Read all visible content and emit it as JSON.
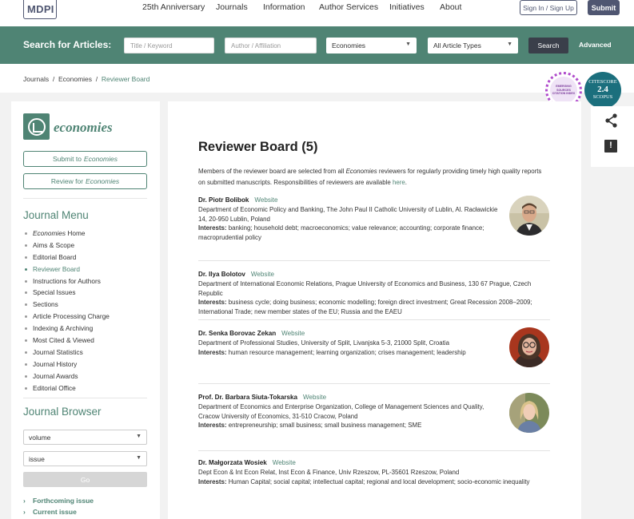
{
  "topnav": {
    "logo": "MDPI",
    "links": [
      "25th Anniversary",
      "Journals",
      "Information",
      "Author Services",
      "Initiatives",
      "About"
    ],
    "sign_in": "Sign In / Sign Up",
    "submit": "Submit"
  },
  "search": {
    "label": "Search for Articles:",
    "title_placeholder": "Title / Keyword",
    "author_placeholder": "Author / Affiliation",
    "journal_value": "Economies",
    "type_value": "All Article Types",
    "search_button": "Search",
    "advanced": "Advanced"
  },
  "breadcrumb": {
    "journals": "Journals",
    "sep": "/",
    "journal": "Economies",
    "current": "Reviewer Board"
  },
  "sidebar": {
    "journal_name": "economies",
    "submit_label": "Submit to",
    "review_label": "Review for",
    "journal_italic": "Economies",
    "menu_heading": "Journal Menu",
    "menu_home_italic": "Economies",
    "menu_home_rest": " Home",
    "menu_items": [
      "Aims & Scope",
      "Editorial Board",
      "Reviewer Board",
      "Instructions for Authors",
      "Special Issues",
      "Sections",
      "Article Processing Charge",
      "Indexing & Archiving",
      "Most Cited & Viewed",
      "Journal Statistics",
      "Journal History",
      "Journal Awards",
      "Editorial Office"
    ],
    "browser_heading": "Journal Browser",
    "volume_value": "volume",
    "issue_value": "issue",
    "go_button": "Go",
    "forthcoming": "Forthcoming issue",
    "current_issue": "Current issue"
  },
  "main": {
    "title": "Reviewer Board (5)",
    "intro_part1": "Members of the reviewer board are selected from all ",
    "intro_italic": "Economies",
    "intro_part2": " reviewers for regularly providing timely high quality reports on submitted manuscripts. Responsibilities of reviewers are available ",
    "intro_link": "here",
    "intro_end": ".",
    "website_label": "Website",
    "interests_label": "Interests:",
    "reviewers": [
      {
        "name": "Dr. Piotr Bolibok",
        "affiliation": "Department of Economic Policy and Banking, The John Paul II Catholic University of Lublin, Al. Racławickie 14, 20-950 Lublin, Poland",
        "interests": "banking; household debt; macroeconomics; value relevance; accounting; corporate finance; macroprudential policy"
      },
      {
        "name": "Dr. Ilya Bolotov",
        "affiliation": "Department of International Economic Relations, Prague University of Economics and Business, 130 67 Prague, Czech Republic",
        "interests": "business cycle; doing business; economic modelling; foreign direct investment; Great Recession 2008–2009; International Trade; new member states of the EU; Russia and the EAEU"
      },
      {
        "name": "Dr. Senka Borovac Zekan",
        "affiliation": "Department of Professional Studies, University of Split, Livanjska 5-3, 21000 Split, Croatia",
        "interests": "human resource management; learning organization; crises management; leadership"
      },
      {
        "name": "Prof. Dr. Barbara Siuta-Tokarska",
        "affiliation": "Department of Economics and Enterprise Organization, College of Management Sciences and Quality, Cracow University of Economics, 31-510 Cracow, Poland",
        "interests": "entrepreneurship; small business; small business management; SME"
      },
      {
        "name": "Dr. Małgorzata Wosiek",
        "affiliation": "Dept Econ & Int Econ Relat, Inst Econ & Finance, Univ Rzeszow, PL-35601 Rzeszow, Poland",
        "interests": "Human Capital; social capital; intellectual capital; regional and local development; socio-economic inequality"
      }
    ]
  },
  "badges": {
    "eci_text": "EMERGING SOURCES CITATION INDEX",
    "citescore_label": "CITESCORE",
    "citescore_value": "2.4",
    "citescore_source": "SCOPUS"
  },
  "icons": {
    "share": "share-icon",
    "comment": "comment-icon"
  },
  "colors": {
    "brand_green": "#4f8474",
    "mdpi_navy": "#4f5671",
    "citescore_teal": "#1b6f7d"
  }
}
